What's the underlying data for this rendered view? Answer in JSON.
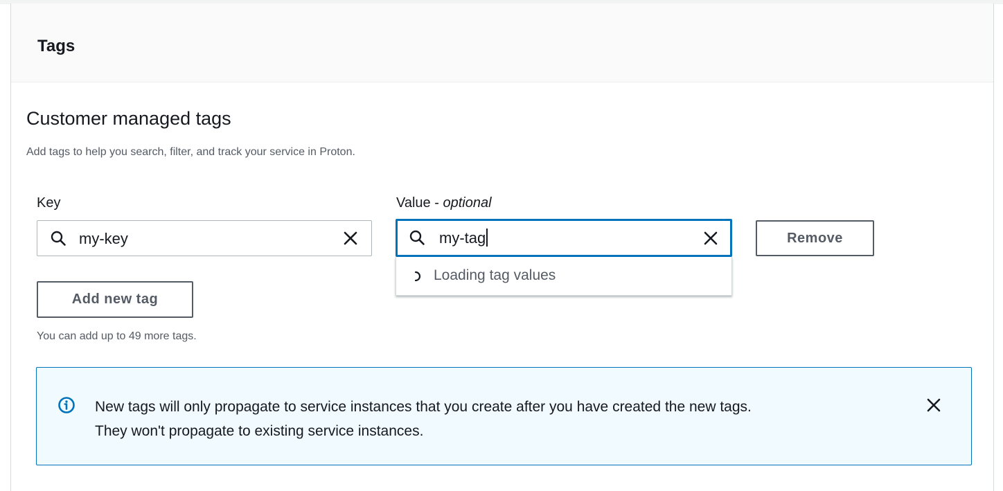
{
  "panel": {
    "title": "Tags"
  },
  "section": {
    "heading": "Customer managed tags",
    "description": "Add tags to help you search, filter, and track your service in Proton."
  },
  "fields": {
    "key_label": "Key",
    "value_label_main": "Value - ",
    "value_label_optional": "optional"
  },
  "tag_row": {
    "key_value": "my-key",
    "value_value": "my-tag",
    "remove_label": "Remove"
  },
  "dropdown": {
    "loading_text": "Loading tag values"
  },
  "actions": {
    "add_label": "Add new tag",
    "limit_text": "You can add up to 49 more tags."
  },
  "alert": {
    "line1": "New tags will only propagate to service instances that you create after you have created the new tags.",
    "line2": "They won't propagate to existing service instances."
  },
  "icons": {
    "search": "search-icon",
    "clear": "close-icon",
    "spinner": "spinner-icon",
    "info": "info-icon",
    "dismiss": "close-icon"
  },
  "colors": {
    "accent": "#0073bb",
    "alert_bg": "#f1faff",
    "text_primary": "#16191f",
    "text_secondary": "#545b64",
    "border": "#aab7b8"
  }
}
